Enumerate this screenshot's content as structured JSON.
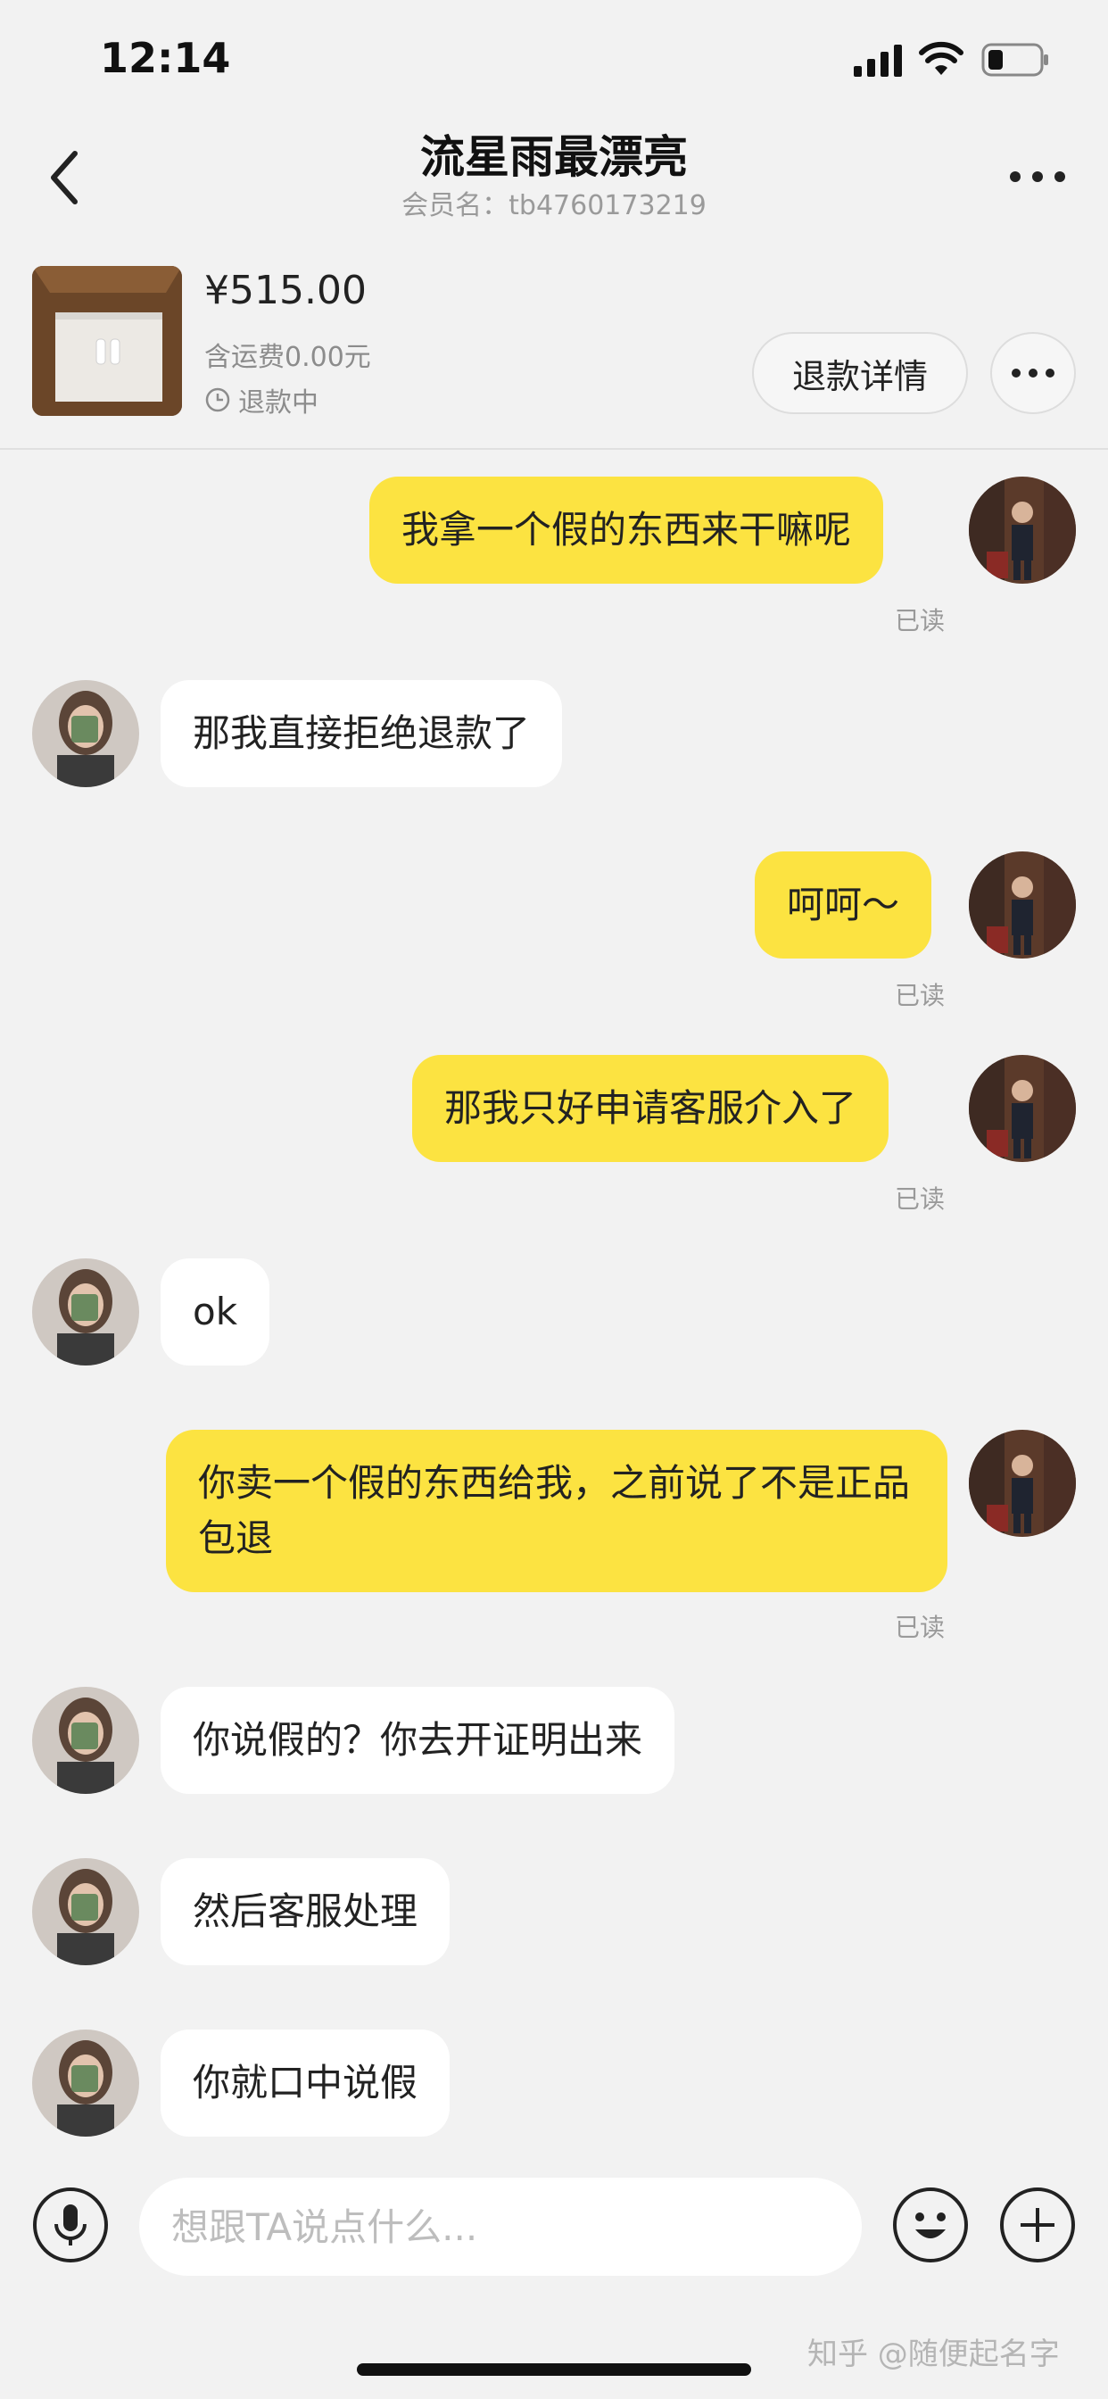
{
  "status_bar": {
    "time": "12:14"
  },
  "header": {
    "title": "流星雨最漂亮",
    "member_label": "会员名：",
    "member_id": "tb4760173219"
  },
  "product": {
    "price": "¥515.00",
    "shipping": "含运费0.00元",
    "status": "退款中",
    "refund_detail_label": "退款详情"
  },
  "messages": [
    {
      "sender": "me",
      "text": "我拿一个假的东西来干嘛呢",
      "read": "已读"
    },
    {
      "sender": "them",
      "text": "那我直接拒绝退款了"
    },
    {
      "sender": "me",
      "text": "呵呵～",
      "read": "已读"
    },
    {
      "sender": "me",
      "text": "那我只好申请客服介入了",
      "read": "已读"
    },
    {
      "sender": "them",
      "text": "ok"
    },
    {
      "sender": "me",
      "text": "你卖一个假的东西给我，之前说了不是正品包退",
      "read": "已读"
    },
    {
      "sender": "them",
      "text": "你说假的？你去开证明出来"
    },
    {
      "sender": "them",
      "text": "然后客服处理"
    },
    {
      "sender": "them",
      "text": "你就口中说假"
    }
  ],
  "input": {
    "placeholder": "想跟TA说点什么..."
  },
  "watermark": "知乎 @随便起名字",
  "colors": {
    "my_bubble": "#fce341",
    "their_bubble": "#ffffff",
    "background": "#f2f2f2"
  },
  "icons": [
    "back-arrow-icon",
    "more-icon",
    "clock-icon",
    "microphone-icon",
    "emoji-icon",
    "plus-icon"
  ]
}
